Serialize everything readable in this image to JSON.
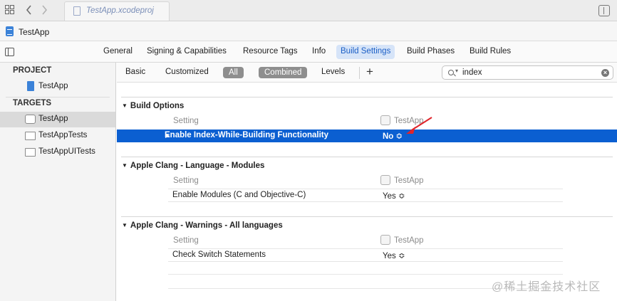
{
  "tabbar": {
    "document_tab": "TestApp.xcodeproj",
    "icons": [
      "grid-icon",
      "back-chevron-icon",
      "forward-chevron-icon",
      "split-editor-icon"
    ]
  },
  "jumpbar": {
    "project": "TestApp"
  },
  "editor_tabs": [
    {
      "label": "General"
    },
    {
      "label": "Signing & Capabilities"
    },
    {
      "label": "Resource Tags"
    },
    {
      "label": "Info"
    },
    {
      "label": "Build Settings",
      "active": true
    },
    {
      "label": "Build Phases"
    },
    {
      "label": "Build Rules"
    }
  ],
  "outline": {
    "project_header": "PROJECT",
    "project_item": "TestApp",
    "targets_header": "TARGETS",
    "targets": [
      {
        "label": "TestApp",
        "selected": true
      },
      {
        "label": "TestAppTests"
      },
      {
        "label": "TestAppUITests"
      }
    ]
  },
  "filter": {
    "basic": "Basic",
    "customized": "Customized",
    "all": "All",
    "combined": "Combined",
    "levels": "Levels",
    "add": "+",
    "search_value": "index"
  },
  "columns": {
    "setting": "Setting",
    "target": "TestApp"
  },
  "groups": [
    {
      "title": "Build Options",
      "rows": [
        {
          "name": "Enable Index-While-Building Functionality",
          "value": "No ≎",
          "selected": true
        }
      ]
    },
    {
      "title": "Apple Clang - Language - Modules",
      "rows": [
        {
          "name": "Enable Modules (C and Objective-C)",
          "value": "Yes ≎"
        }
      ]
    },
    {
      "title": "Apple Clang - Warnings - All languages",
      "rows": [
        {
          "name": "Check Switch Statements",
          "value": "Yes ≎"
        }
      ]
    }
  ],
  "colors": {
    "accent": "#0b5fd1",
    "active_tab_bg": "#d6e4f8",
    "active_tab_text": "#1b5fc6",
    "annotation_arrow": "#e0242a"
  },
  "watermark": "@稀土掘金技术社区"
}
